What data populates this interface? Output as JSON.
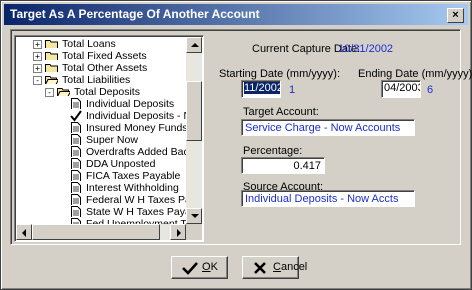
{
  "window": {
    "title": "Target As A Percentage Of Another Account"
  },
  "tree": {
    "items": [
      {
        "label": "Total Loans",
        "type": "folder",
        "expander": "+"
      },
      {
        "label": "Total Fixed Assets",
        "type": "folder",
        "expander": "+"
      },
      {
        "label": "Total Other Assets",
        "type": "folder",
        "expander": "+"
      },
      {
        "label": "Total Liabilities",
        "type": "folder-open",
        "expander": "-"
      },
      {
        "label": "Total Deposits",
        "type": "folder-open",
        "expander": "-"
      },
      {
        "label": "Individual Deposits",
        "type": "doc"
      },
      {
        "label": "Individual Deposits - Now Accts",
        "type": "check",
        "selected": true
      },
      {
        "label": "Insured Money Funds",
        "type": "doc"
      },
      {
        "label": "Super Now",
        "type": "doc"
      },
      {
        "label": "Overdrafts Added Back",
        "type": "doc"
      },
      {
        "label": "DDA Unposted",
        "type": "doc"
      },
      {
        "label": "FICA Taxes Payable",
        "type": "doc"
      },
      {
        "label": "Interest Withholding",
        "type": "doc"
      },
      {
        "label": "Federal W H Taxes Payable",
        "type": "doc"
      },
      {
        "label": "State W H Taxes Payable",
        "type": "doc"
      },
      {
        "label": "Fed Unemployment Taxes Payal",
        "type": "doc"
      }
    ]
  },
  "form": {
    "capture_date_label": "Current Capture Date:",
    "capture_date_value": "10/31/2002",
    "starting_date_label": "Starting Date (mm/yyyy):",
    "starting_date_value": "11/2002",
    "starting_count": "1",
    "ending_date_label": "Ending Date (mm/yyyy):",
    "ending_date_value": "04/2003",
    "ending_count": "6",
    "target_account_label": "Target Account:",
    "target_account_value": "Service Charge - Now Accounts",
    "percentage_label": "Percentage:",
    "percentage_value": "0.417",
    "source_account_label": "Source Account:",
    "source_account_value": "Individual Deposits - Now Accts"
  },
  "buttons": {
    "ok_label": "OK",
    "ok_mnemonic": "O",
    "ok_rest": "K",
    "cancel_label": "Cancel",
    "cancel_mnemonic": "C",
    "cancel_rest": "ancel"
  },
  "colors": {
    "value_blue": "#1a2fd0",
    "title_start": "#0a246a",
    "title_end": "#a6caf0"
  }
}
